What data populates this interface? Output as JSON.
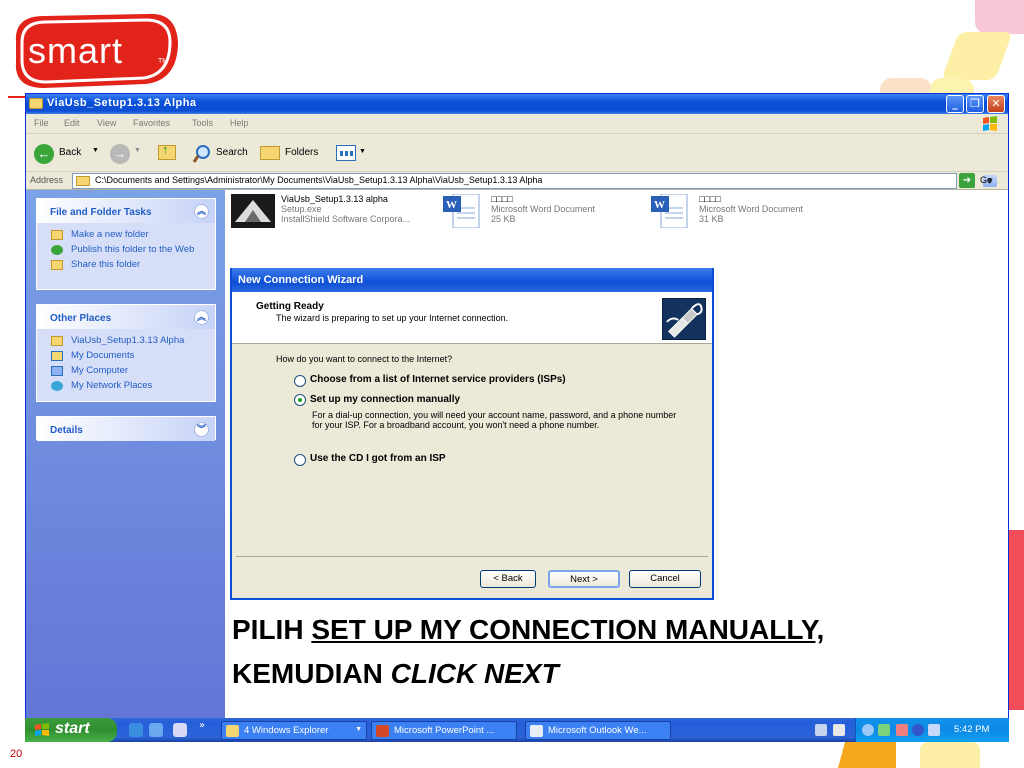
{
  "slide": {
    "logo_text": "smart",
    "logo_tm": "TM",
    "slide_number": "20",
    "caption": {
      "part1": "PILIH ",
      "underlined": "SET UP MY CONNECTION MANUALLY,",
      "part2": "KEMUDIAN ",
      "italic": "CLICK NEXT"
    }
  },
  "window": {
    "title": "ViaUsb_Setup1.3.13 Alpha",
    "menu": [
      "File",
      "Edit",
      "View",
      "Favorites",
      "Tools",
      "Help"
    ],
    "toolbar": {
      "back": "Back",
      "search": "Search",
      "folders": "Folders"
    },
    "address": {
      "label": "Address",
      "value": "C:\\Documents and Settings\\Administrator\\My Documents\\ViaUsb_Setup1.3.13 Alpha\\ViaUsb_Setup1.3.13 Alpha",
      "go": "Go"
    }
  },
  "leftpane": {
    "file_tasks": {
      "title": "File and Folder Tasks",
      "items": [
        "Make a new folder",
        "Publish this folder to the Web",
        "Share this folder"
      ]
    },
    "other_places": {
      "title": "Other Places",
      "items": [
        "ViaUsb_Setup1.3.13 Alpha",
        "My Documents",
        "My Computer",
        "My Network Places"
      ]
    },
    "details": {
      "title": "Details"
    }
  },
  "files": [
    {
      "name": "ViaUsb_Setup1.3.13 alpha",
      "line2": "Setup.exe",
      "line3": "InstallShield Software Corpora..."
    },
    {
      "name": "□□□□",
      "line2": "Microsoft Word Document",
      "line3": "25 KB"
    },
    {
      "name": "□□□□",
      "line2": "Microsoft Word Document",
      "line3": "31 KB"
    }
  ],
  "wizard": {
    "title": "New Connection Wizard",
    "heading": "Getting Ready",
    "subheading": "The wizard is preparing to set up your Internet connection.",
    "question": "How do you want to connect to the Internet?",
    "options": [
      "Choose from a list of Internet service providers (ISPs)",
      "Set up my connection manually",
      "Use the CD I got from an ISP"
    ],
    "selected_option": 1,
    "manual_description": "For a dial-up connection, you will need your account name, password, and a phone number for your ISP. For a broadband account, you won't need a phone number.",
    "buttons": {
      "back": "< Back",
      "next": "Next >",
      "cancel": "Cancel"
    }
  },
  "taskbar": {
    "start": "start",
    "more": "»",
    "buttons": [
      "4 Windows Explorer",
      "Microsoft PowerPoint ...",
      "Microsoft Outlook We..."
    ],
    "clock": "5:42 PM"
  },
  "colors": {
    "xp_blue": "#0a4fd8",
    "start_green": "#3c9a3c",
    "logo_red": "#e2231a",
    "link_blue": "#215dc6"
  }
}
